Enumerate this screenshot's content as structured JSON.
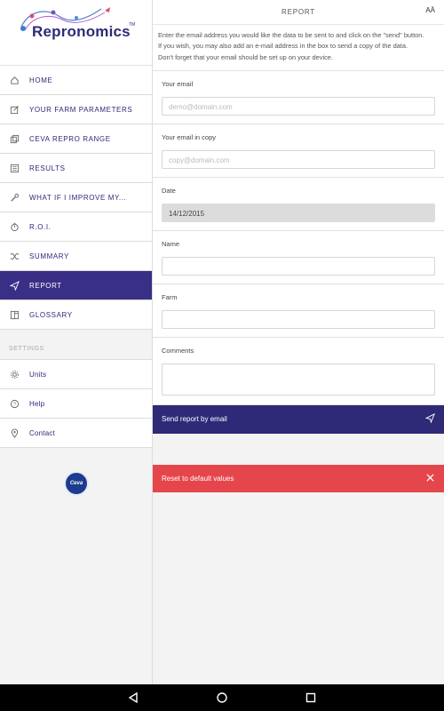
{
  "app": {
    "name": "Repronomics",
    "tm": "TM"
  },
  "sidebar": {
    "items": [
      {
        "label": "HOME",
        "icon": "home-icon"
      },
      {
        "label": "YOUR FARM PARAMETERS",
        "icon": "edit-icon"
      },
      {
        "label": "CEVA REPRO RANGE",
        "icon": "copy-icon"
      },
      {
        "label": "RESULTS",
        "icon": "list-icon"
      },
      {
        "label": "WHAT IF I IMPROVE MY...",
        "icon": "wrench-icon"
      },
      {
        "label": "R.O.I.",
        "icon": "timer-icon"
      },
      {
        "label": "SUMMARY",
        "icon": "shuffle-icon"
      },
      {
        "label": "REPORT",
        "icon": "send-icon",
        "active": true
      },
      {
        "label": "GLOSSARY",
        "icon": "book-icon"
      }
    ],
    "settings_header": "SETTINGS",
    "settings_items": [
      {
        "label": "Units",
        "icon": "gear-icon"
      },
      {
        "label": "Help",
        "icon": "help-icon"
      },
      {
        "label": "Contact",
        "icon": "pin-icon"
      }
    ],
    "ceva_logo": "Ceva"
  },
  "header": {
    "title": "REPORT",
    "font_icon": "AÄ"
  },
  "intro": {
    "line1": "Enter the email address you would like the data to be sent to and click on the \"send\" button.",
    "line2": "If you wish, you may also add an e-mail address in the box to send a copy of the data.",
    "line3": "Don't forget that your email should be set up on your device."
  },
  "form": {
    "email": {
      "label": "Your email",
      "placeholder": "demo@domain.com",
      "value": ""
    },
    "email_copy": {
      "label": "Your email in copy",
      "placeholder": "copy@domain.com",
      "value": ""
    },
    "date": {
      "label": "Date",
      "value": "14/12/2015"
    },
    "name": {
      "label": "Name",
      "value": ""
    },
    "farm": {
      "label": "Farm",
      "value": ""
    },
    "comments": {
      "label": "Comments",
      "value": ""
    }
  },
  "actions": {
    "send_label": "Send report by email",
    "reset_label": "Reset to default values"
  },
  "colors": {
    "primary": "#2e2a78",
    "danger": "#e5464c"
  }
}
